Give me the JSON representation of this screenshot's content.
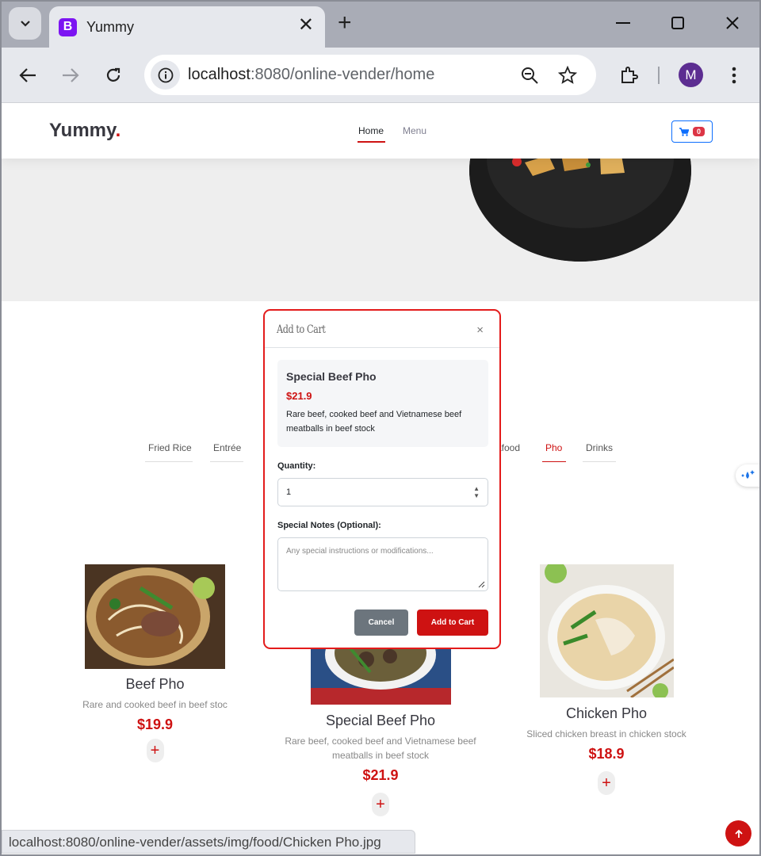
{
  "browser": {
    "tab_title": "Yummy",
    "favicon_letter": "B",
    "url_host": "localhost",
    "url_rest": ":8080/online-vender/home",
    "profile_initial": "M",
    "status_url": "localhost:8080/online-vender/assets/img/food/Chicken Pho.jpg"
  },
  "site": {
    "logo": "Yummy",
    "logo_dot": ".",
    "nav": [
      "Home",
      "Menu"
    ],
    "cart_count": "0"
  },
  "menu_tabs": [
    "Fried Rice",
    "Entrée",
    "afood",
    "Pho",
    "Drinks"
  ],
  "active_tab": "Pho",
  "items": [
    {
      "name": "Beef Pho",
      "desc": "Rare and cooked beef in beef stoc",
      "price": "$19.9"
    },
    {
      "name": "Special Beef Pho",
      "desc": "Rare beef, cooked beef and Vietnamese beef meatballs in beef stock",
      "price": "$21.9"
    },
    {
      "name": "Chicken Pho",
      "desc": "Sliced chicken breast in chicken stock",
      "price": "$18.9"
    }
  ],
  "modal": {
    "title": "Add to Cart",
    "close": "×",
    "item_name": "Special Beef Pho",
    "item_price": "$21.9",
    "item_desc": "Rare beef, cooked beef and Vietnamese beef meatballs in beef stock",
    "quantity_label": "Quantity:",
    "quantity_value": "1",
    "notes_label": "Special Notes (Optional):",
    "notes_placeholder": "Any special instructions or modifications...",
    "cancel_label": "Cancel",
    "add_label": "Add to Cart"
  },
  "colors": {
    "accent": "#ce1212",
    "primary": "#0d6efd",
    "secondary": "#6c757d"
  }
}
